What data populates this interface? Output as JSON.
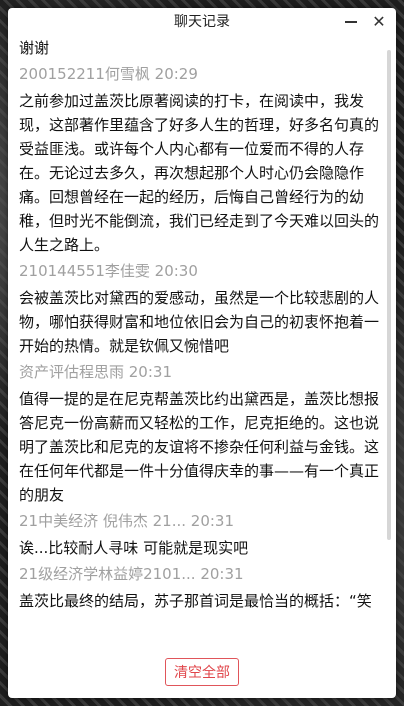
{
  "window": {
    "title": "聊天记录"
  },
  "icons": {
    "minimize": "minimize-icon",
    "close": "close-icon"
  },
  "messages": [
    {
      "text": "谢谢"
    },
    {
      "meta": "200152211何雪枫 20:29",
      "text": "之前参加过盖茨比原著阅读的打卡，在阅读中，我发现，这部著作里蕴含了好多人生的哲理，好多名句真的受益匪浅。或许每个人内心都有一位爱而不得的人存在。无论过去多久，再次想起那个人时心仍会隐隐作痛。回想曾经在一起的经历，后悔自己曾经行为的幼稚，但时光不能倒流，我们已经走到了今天难以回头的人生之路上。"
    },
    {
      "meta": "210144551李佳雯 20:30",
      "text": "会被盖茨比对黛西的爱感动，虽然是一个比较悲剧的人物，哪怕获得财富和地位依旧会为自己的初衷怀抱着一开始的热情。就是钦佩又惋惜吧"
    },
    {
      "meta": "资产评估程思雨 20:31",
      "text": "值得一提的是在尼克帮盖茨比约出黛西是，盖茨比想报答尼克一份高薪而又轻松的工作，尼克拒绝的。这也说明了盖茨比和尼克的友谊将不掺杂任何利益与金钱。这在任何年代都是一件十分值得庆幸的事——有一个真正的朋友"
    },
    {
      "meta": "21中美经济 倪伟杰 21... 20:31",
      "text": "诶...比较耐人寻味 可能就是现实吧"
    },
    {
      "meta": "21级经济学林益婷2101... 20:31",
      "text": "盖茨比最终的结局，苏子那首词是最恰当的概括：“笑"
    }
  ],
  "footer": {
    "clear_all_label": "清空全部"
  },
  "colors": {
    "accent_red": "#e0454a",
    "meta_gray": "#a0a0a0"
  }
}
